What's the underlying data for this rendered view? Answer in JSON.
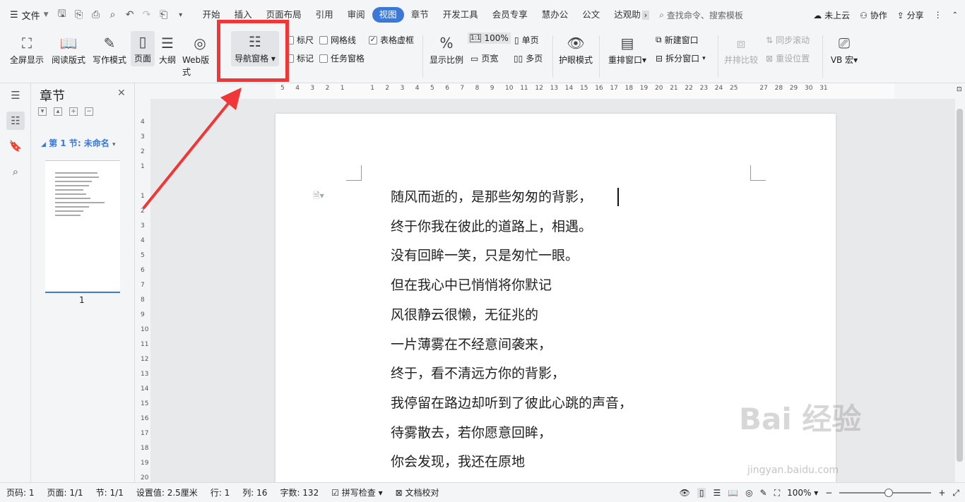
{
  "topbar": {
    "file_label": "文件",
    "tabs": [
      "开始",
      "插入",
      "页面布局",
      "引用",
      "审阅",
      "视图",
      "章节",
      "开发工具",
      "会员专享",
      "慧办公",
      "公文",
      "达观助"
    ],
    "active_tab": "视图",
    "search_label": "查找命令、搜索模板",
    "cloud_label": "未上云",
    "collab_label": "协作",
    "share_label": "分享"
  },
  "ribbon": {
    "fullscreen": "全屏显示",
    "reading": "阅读版式",
    "writing": "写作模式",
    "page": "页面",
    "outline": "大纲",
    "web": "Web版式",
    "navpane": "导航窗格",
    "ruler": "标尺",
    "gridlines": "网格线",
    "table_border": "表格虚框",
    "marks": "标记",
    "taskpane": "任务窗格",
    "zoom_ratio": "显示比例",
    "zoom_value": "100%",
    "page_width": "页宽",
    "single_page": "单页",
    "multi_page": "多页",
    "eye_mode": "护眼模式",
    "arrange_window": "重排窗口",
    "new_window": "新建窗口",
    "split_window": "拆分窗口",
    "side_compare": "并排比较",
    "sync_scroll": "同步滚动",
    "reset_pos": "重设位置",
    "vb_macro": "VB 宏"
  },
  "navpane": {
    "title": "章节",
    "section_label": "第 1 节: 未命名",
    "page_number": "1"
  },
  "ruler": {
    "h_ticks": [
      "5",
      "4",
      "3",
      "2",
      "1",
      "",
      "1",
      "2",
      "3",
      "4",
      "5",
      "6",
      "7",
      "8",
      "9",
      "10",
      "11",
      "12",
      "13",
      "14",
      "15",
      "16",
      "17",
      "18",
      "19",
      "20",
      "21",
      "22",
      "23",
      "24",
      "25",
      "",
      "27",
      "28",
      "29",
      "30",
      "31"
    ],
    "v_ticks": [
      "4",
      "3",
      "2",
      "1",
      "",
      "1",
      "2",
      "3",
      "4",
      "5",
      "6",
      "7",
      "8",
      "9",
      "10",
      "11",
      "12",
      "13",
      "14",
      "15",
      "16",
      "17",
      "18",
      "19",
      "20"
    ]
  },
  "document": {
    "lines": [
      "随风而逝的，是那些匆匆的背影，",
      "终于你我在彼此的道路上，相遇。",
      "没有回眸一笑，只是匆忙一眼。",
      "但在我心中已悄悄将你默记",
      "风很静云很懒，无征兆的",
      "一片薄雾在不经意间袭来，",
      "终于，看不清远方你的背影，",
      "我停留在路边却听到了彼此心跳的声音，",
      "待雾散去，若你愿意回眸，",
      "你会发现，我还在原地"
    ]
  },
  "status": {
    "page_code": "页码: 1",
    "pages": "页面: 1/1",
    "section": "节: 1/1",
    "settings": "设置值: 2.5厘米",
    "row": "行: 1",
    "col": "列: 16",
    "words": "字数: 132",
    "spell": "拼写检查",
    "doc_check": "文档校对",
    "zoom": "100%"
  },
  "watermark": {
    "brand": "Bai 经验",
    "url": "jingyan.baidu.com"
  },
  "colors": {
    "accent": "#3c78d8",
    "highlight": "#f03636"
  }
}
